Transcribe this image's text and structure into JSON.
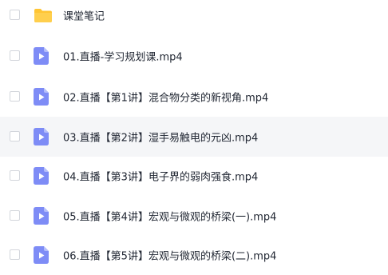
{
  "colors": {
    "folder": "#ffc533",
    "video": "#7e8cf6",
    "text": "#212733",
    "checkbox_border": "#d3d6dc",
    "hover_row": "#f5f6f8"
  },
  "files": [
    {
      "icon": "folder-icon",
      "name": "课堂笔记"
    },
    {
      "icon": "video-file-icon",
      "name": "01.直播-学习规划课.mp4"
    },
    {
      "icon": "video-file-icon",
      "name": "02.直播【第1讲】混合物分类的新视角.mp4"
    },
    {
      "icon": "video-file-icon",
      "name": "03.直播【第2讲】湿手易触电的元凶.mp4"
    },
    {
      "icon": "video-file-icon",
      "name": "04.直播【第3讲】电子界的弱肉强食.mp4"
    },
    {
      "icon": "video-file-icon",
      "name": "05.直播【第4讲】宏观与微观的桥梁(一).mp4"
    },
    {
      "icon": "video-file-icon",
      "name": "06.直播【第5讲】宏观与微观的桥梁(二).mp4"
    }
  ]
}
